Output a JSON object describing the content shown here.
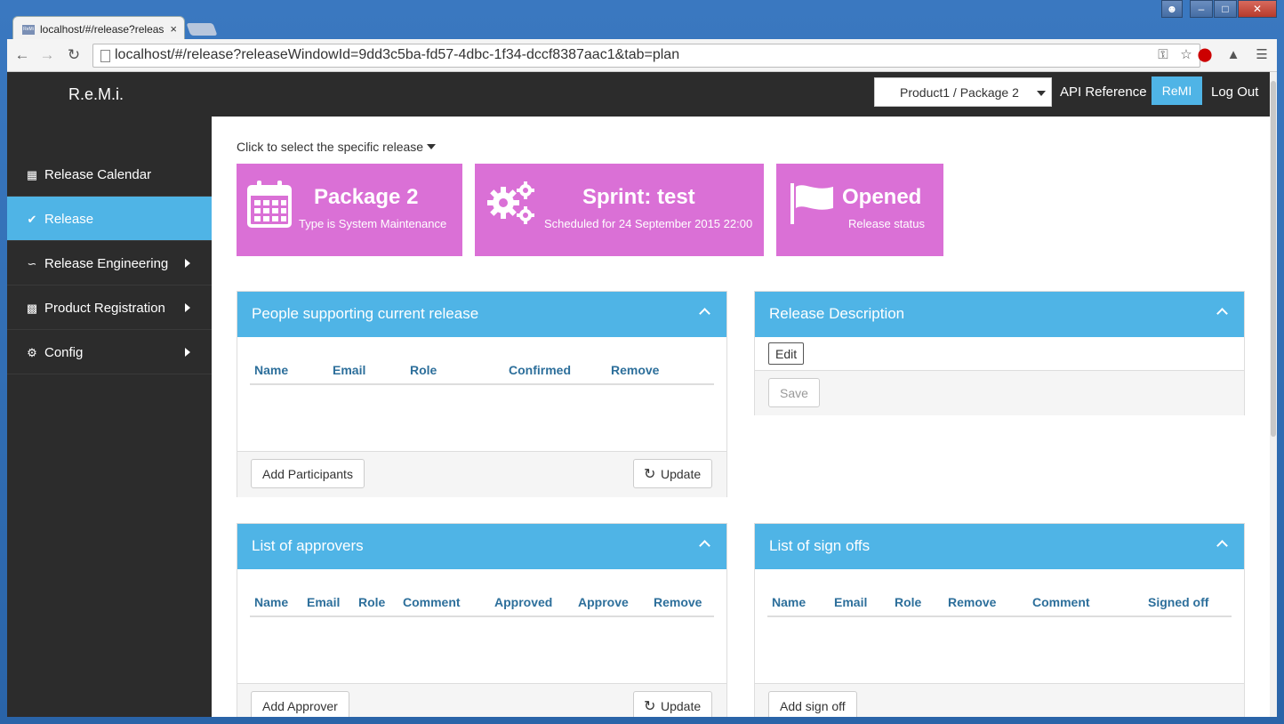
{
  "browser": {
    "tab_title": "localhost/#/release?releas",
    "tab_close": "×",
    "favicon_text": "ReMi",
    "url": "localhost/#/release?releaseWindowId=9dd3c5ba-fd57-4dbc-1f34-dccf8387aac1&tab=plan"
  },
  "topnav": {
    "brand": "R.e.M.i.",
    "product_selector": "Product1 / Package 2",
    "api_reference": "API Reference",
    "remi": "ReMI",
    "logout": "Log Out"
  },
  "sidebar": {
    "items": [
      {
        "label": "Release Calendar",
        "icon": "calendar-icon",
        "active": false,
        "submenu": false
      },
      {
        "label": "Release",
        "icon": "check-icon",
        "active": true,
        "submenu": false
      },
      {
        "label": "Release Engineering",
        "icon": "chart-icon",
        "active": false,
        "submenu": true
      },
      {
        "label": "Product Registration",
        "icon": "puzzle-icon",
        "active": false,
        "submenu": true
      },
      {
        "label": "Config",
        "icon": "gear-icon",
        "active": false,
        "submenu": true
      }
    ]
  },
  "release_picker": "Click to select the specific release",
  "tiles": {
    "package": {
      "title": "Package 2",
      "subtitle": "Type is System Maintenance",
      "icon": "calendar-icon"
    },
    "sprint": {
      "title": "Sprint: test",
      "subtitle": "Scheduled for 24 September 2015 22:00",
      "icon": "gears-icon"
    },
    "status": {
      "title": "Opened",
      "subtitle": "Release status",
      "icon": "flag-icon"
    }
  },
  "panels": {
    "people": {
      "title": "People supporting current release",
      "columns": [
        "Name",
        "Email",
        "Role",
        "Confirmed",
        "Remove"
      ],
      "add_button": "Add Participants",
      "update_button": "Update"
    },
    "description": {
      "title": "Release Description",
      "edit_button": "Edit",
      "save_button": "Save"
    },
    "approvers": {
      "title": "List of approvers",
      "columns": [
        "Name",
        "Email",
        "Role",
        "Comment",
        "Approved",
        "Approve",
        "Remove"
      ],
      "add_button": "Add Approver",
      "update_button": "Update"
    },
    "signoffs": {
      "title": "List of sign offs",
      "columns": [
        "Name",
        "Email",
        "Role",
        "Remove",
        "Comment",
        "Signed off"
      ],
      "add_button": "Add sign off"
    }
  },
  "colors": {
    "accent": "#4fb4e6",
    "tile": "#da70d6",
    "dark": "#2c2c2c"
  }
}
